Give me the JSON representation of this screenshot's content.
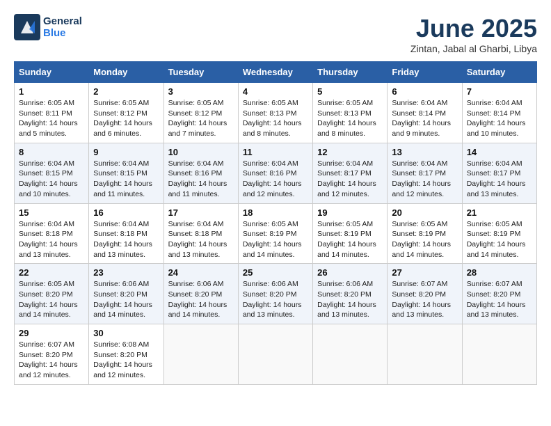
{
  "header": {
    "logo_line1": "General",
    "logo_line2": "Blue",
    "month": "June 2025",
    "location": "Zintan, Jabal al Gharbi, Libya"
  },
  "days_of_week": [
    "Sunday",
    "Monday",
    "Tuesday",
    "Wednesday",
    "Thursday",
    "Friday",
    "Saturday"
  ],
  "weeks": [
    [
      {
        "day": 1,
        "info": "Sunrise: 6:05 AM\nSunset: 8:11 PM\nDaylight: 14 hours and 5 minutes."
      },
      {
        "day": 2,
        "info": "Sunrise: 6:05 AM\nSunset: 8:12 PM\nDaylight: 14 hours and 6 minutes."
      },
      {
        "day": 3,
        "info": "Sunrise: 6:05 AM\nSunset: 8:12 PM\nDaylight: 14 hours and 7 minutes."
      },
      {
        "day": 4,
        "info": "Sunrise: 6:05 AM\nSunset: 8:13 PM\nDaylight: 14 hours and 8 minutes."
      },
      {
        "day": 5,
        "info": "Sunrise: 6:05 AM\nSunset: 8:13 PM\nDaylight: 14 hours and 8 minutes."
      },
      {
        "day": 6,
        "info": "Sunrise: 6:04 AM\nSunset: 8:14 PM\nDaylight: 14 hours and 9 minutes."
      },
      {
        "day": 7,
        "info": "Sunrise: 6:04 AM\nSunset: 8:14 PM\nDaylight: 14 hours and 10 minutes."
      }
    ],
    [
      {
        "day": 8,
        "info": "Sunrise: 6:04 AM\nSunset: 8:15 PM\nDaylight: 14 hours and 10 minutes."
      },
      {
        "day": 9,
        "info": "Sunrise: 6:04 AM\nSunset: 8:15 PM\nDaylight: 14 hours and 11 minutes."
      },
      {
        "day": 10,
        "info": "Sunrise: 6:04 AM\nSunset: 8:16 PM\nDaylight: 14 hours and 11 minutes."
      },
      {
        "day": 11,
        "info": "Sunrise: 6:04 AM\nSunset: 8:16 PM\nDaylight: 14 hours and 12 minutes."
      },
      {
        "day": 12,
        "info": "Sunrise: 6:04 AM\nSunset: 8:17 PM\nDaylight: 14 hours and 12 minutes."
      },
      {
        "day": 13,
        "info": "Sunrise: 6:04 AM\nSunset: 8:17 PM\nDaylight: 14 hours and 12 minutes."
      },
      {
        "day": 14,
        "info": "Sunrise: 6:04 AM\nSunset: 8:17 PM\nDaylight: 14 hours and 13 minutes."
      }
    ],
    [
      {
        "day": 15,
        "info": "Sunrise: 6:04 AM\nSunset: 8:18 PM\nDaylight: 14 hours and 13 minutes."
      },
      {
        "day": 16,
        "info": "Sunrise: 6:04 AM\nSunset: 8:18 PM\nDaylight: 14 hours and 13 minutes."
      },
      {
        "day": 17,
        "info": "Sunrise: 6:04 AM\nSunset: 8:18 PM\nDaylight: 14 hours and 13 minutes."
      },
      {
        "day": 18,
        "info": "Sunrise: 6:05 AM\nSunset: 8:19 PM\nDaylight: 14 hours and 14 minutes."
      },
      {
        "day": 19,
        "info": "Sunrise: 6:05 AM\nSunset: 8:19 PM\nDaylight: 14 hours and 14 minutes."
      },
      {
        "day": 20,
        "info": "Sunrise: 6:05 AM\nSunset: 8:19 PM\nDaylight: 14 hours and 14 minutes."
      },
      {
        "day": 21,
        "info": "Sunrise: 6:05 AM\nSunset: 8:19 PM\nDaylight: 14 hours and 14 minutes."
      }
    ],
    [
      {
        "day": 22,
        "info": "Sunrise: 6:05 AM\nSunset: 8:20 PM\nDaylight: 14 hours and 14 minutes."
      },
      {
        "day": 23,
        "info": "Sunrise: 6:06 AM\nSunset: 8:20 PM\nDaylight: 14 hours and 14 minutes."
      },
      {
        "day": 24,
        "info": "Sunrise: 6:06 AM\nSunset: 8:20 PM\nDaylight: 14 hours and 14 minutes."
      },
      {
        "day": 25,
        "info": "Sunrise: 6:06 AM\nSunset: 8:20 PM\nDaylight: 14 hours and 13 minutes."
      },
      {
        "day": 26,
        "info": "Sunrise: 6:06 AM\nSunset: 8:20 PM\nDaylight: 14 hours and 13 minutes."
      },
      {
        "day": 27,
        "info": "Sunrise: 6:07 AM\nSunset: 8:20 PM\nDaylight: 14 hours and 13 minutes."
      },
      {
        "day": 28,
        "info": "Sunrise: 6:07 AM\nSunset: 8:20 PM\nDaylight: 14 hours and 13 minutes."
      }
    ],
    [
      {
        "day": 29,
        "info": "Sunrise: 6:07 AM\nSunset: 8:20 PM\nDaylight: 14 hours and 12 minutes."
      },
      {
        "day": 30,
        "info": "Sunrise: 6:08 AM\nSunset: 8:20 PM\nDaylight: 14 hours and 12 minutes."
      },
      null,
      null,
      null,
      null,
      null
    ]
  ]
}
